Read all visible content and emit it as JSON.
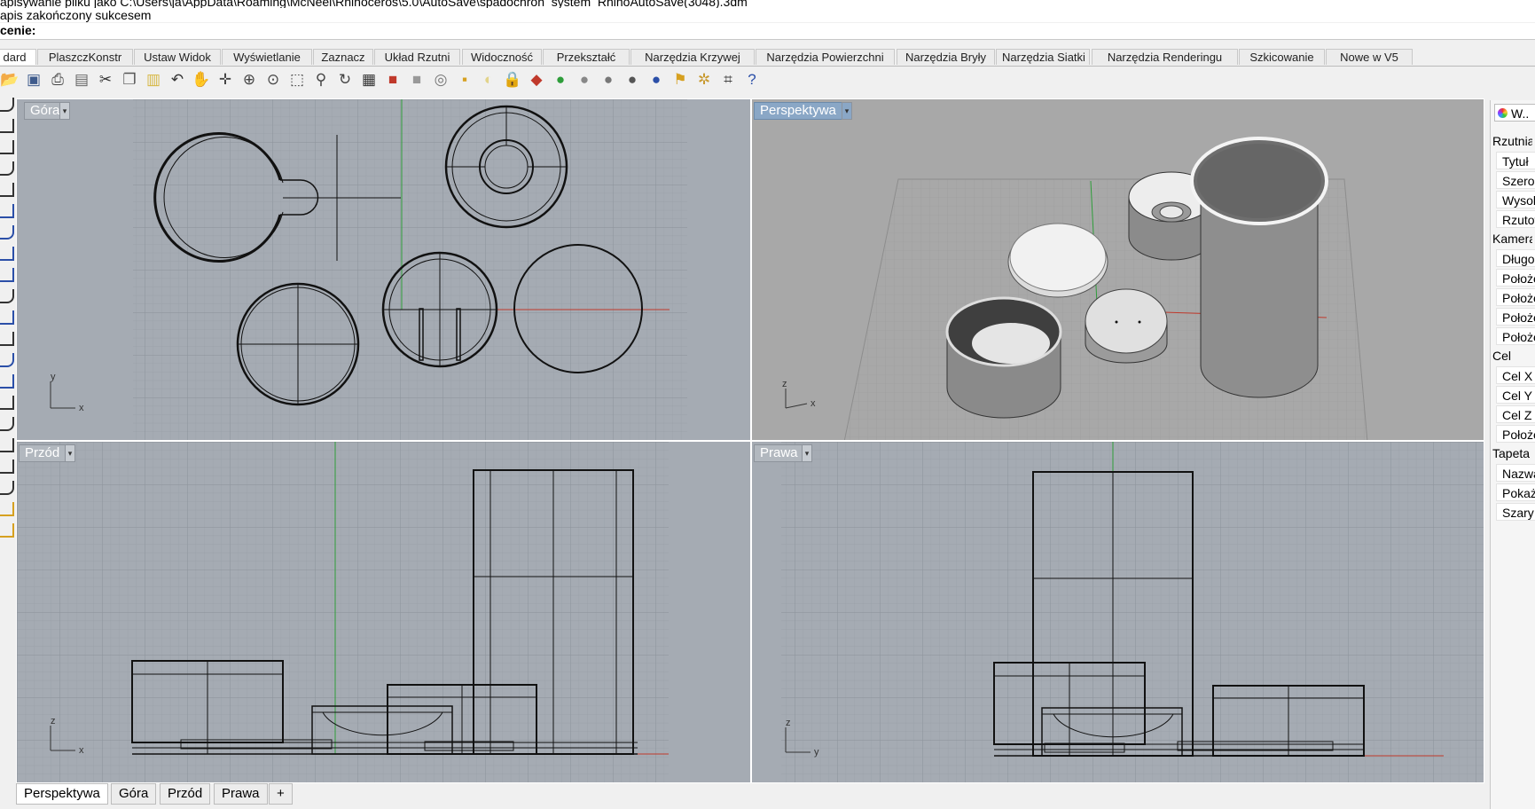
{
  "command_history": {
    "line1": "apisywanie pliku jako C:\\Users\\ja\\AppData\\Roaming\\McNeel\\Rhinoceros\\5.0\\AutoSave\\spadochron_system_RhinoAutoSave(3048).3dm",
    "line2": "apis zakończony sukcesem",
    "prompt": "cenie:"
  },
  "toolbar_tabs": [
    "dard",
    "PlaszczKonstr",
    "Ustaw Widok",
    "Wyświetlanie",
    "Zaznacz",
    "Układ Rzutni",
    "Widoczność",
    "Przekształć",
    "Narzędzia Krzywej",
    "Narzędzia Powierzchni",
    "Narzędzia Bryły",
    "Narzędzia Siatki",
    "Narzędzia Renderingu",
    "Szkicowanie",
    "Nowe w V5"
  ],
  "toolbar_icons": [
    "open-icon",
    "save-icon",
    "print-icon",
    "import-icon",
    "cut-icon",
    "copy-icon",
    "paste-icon",
    "undo-icon",
    "pan-hand-icon",
    "move-view-icon",
    "zoom-icon",
    "zoom-window-icon",
    "zoom-extents-icon",
    "zoom-selected-icon",
    "rotate-view-icon",
    "grid-layout-icon",
    "car-icon",
    "car-shaded-icon",
    "target-icon",
    "object-snap-icon",
    "light-bulb-icon",
    "lock-icon",
    "layer-icon",
    "color-wheel-icon",
    "render-sphere-icon",
    "shaded-sphere-icon",
    "chrome-sphere-icon",
    "blue-sphere-icon",
    "flag-icon",
    "gear-icon",
    "dimension-icon",
    "help-icon"
  ],
  "viewports": {
    "top": {
      "label": "Góra",
      "axis_a": "y",
      "axis_b": "x"
    },
    "perspective": {
      "label": "Perspektywa",
      "axis_a": "z",
      "axis_b": "x"
    },
    "front": {
      "label": "Przód",
      "axis_a": "z",
      "axis_b": "x"
    },
    "right": {
      "label": "Prawa",
      "axis_a": "z",
      "axis_b": "y"
    }
  },
  "viewport_tabs": [
    "Perspektywa",
    "Góra",
    "Przód",
    "Prawa",
    "+"
  ],
  "right_panel": {
    "tab_label": "W..",
    "rows": [
      {
        "text": "Rzutnia",
        "kind": "sec"
      },
      {
        "text": "Tytuł",
        "kind": "field"
      },
      {
        "text": "Szerokość",
        "kind": "field"
      },
      {
        "text": "Wysokość",
        "kind": "field"
      },
      {
        "text": "Rzutowanie",
        "kind": "field"
      },
      {
        "text": "Kamera",
        "kind": "sec"
      },
      {
        "text": "Długość",
        "kind": "field"
      },
      {
        "text": "Położenie",
        "kind": "field"
      },
      {
        "text": "Położenie",
        "kind": "field"
      },
      {
        "text": "Położenie",
        "kind": "field"
      },
      {
        "text": "Położenie",
        "kind": "field"
      },
      {
        "text": "Cel",
        "kind": "sec"
      },
      {
        "text": "Cel X",
        "kind": "field"
      },
      {
        "text": "Cel Y",
        "kind": "field"
      },
      {
        "text": "Cel Z",
        "kind": "field"
      },
      {
        "text": "Położenie",
        "kind": "field"
      },
      {
        "text": "Tapeta",
        "kind": "sec"
      },
      {
        "text": "Nazwa",
        "kind": "field"
      },
      {
        "text": "Pokaż",
        "kind": "field"
      },
      {
        "text": "Szary",
        "kind": "field"
      }
    ]
  },
  "colors": {
    "viewport_bg": "#a5abb3",
    "perspective_bg": "#a9a9a9",
    "grid_line": "#9aa0a8",
    "axis_x": "#c0392b",
    "axis_y": "#2e9d3a",
    "active_label": "#8aa7c6"
  }
}
